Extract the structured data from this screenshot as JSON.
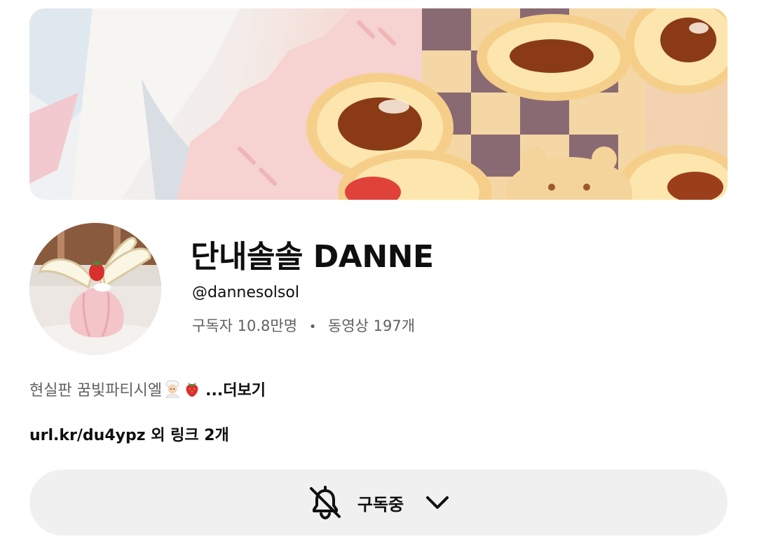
{
  "channel": {
    "name": "단내솔솔 DANNE",
    "handle": "@dannesolsol",
    "subscribers": "구독자 10.8만명",
    "separator": "•",
    "videos": "동영상 197개"
  },
  "description": {
    "text": "현실판 꿈빛파티시엘",
    "emojis": [
      "chef-emoji",
      "strawberry-emoji"
    ],
    "more_label": "...더보기"
  },
  "links": {
    "url": "url.kr/du4ypz",
    "suffix": " 외 링크 2개"
  },
  "subscribe_button": {
    "label": "구독중",
    "icon": "bell-off-icon",
    "dropdown_icon": "chevron-down-icon"
  },
  "colors": {
    "primary_text": "#0f0f0f",
    "secondary_text": "#606060",
    "button_bg": "#f0f0f0"
  }
}
